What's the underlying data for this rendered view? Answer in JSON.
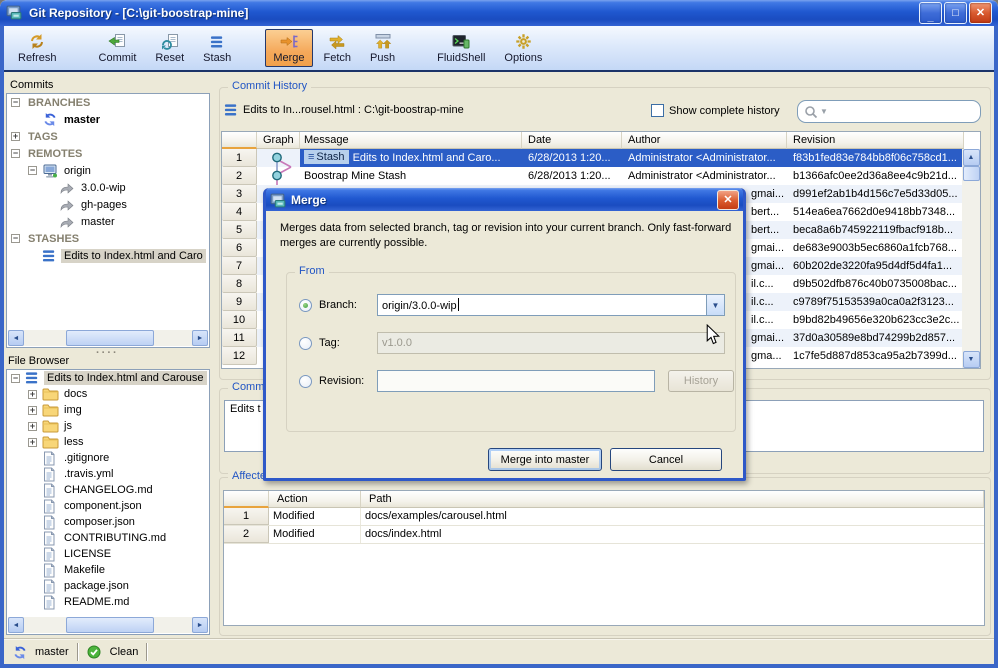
{
  "window": {
    "title": "Git Repository - [C:\\git-boostrap-mine]"
  },
  "toolbar": {
    "items": [
      {
        "id": "refresh",
        "label": "Refresh",
        "icon": "refresh",
        "active": false,
        "gap_before": false
      },
      {
        "id": "commit",
        "label": "Commit",
        "icon": "commit",
        "active": false,
        "gap_before": true
      },
      {
        "id": "reset",
        "label": "Reset",
        "icon": "reset",
        "active": false,
        "gap_before": false
      },
      {
        "id": "stash",
        "label": "Stash",
        "icon": "stash",
        "active": false,
        "gap_before": false
      },
      {
        "id": "merge",
        "label": "Merge",
        "icon": "merge",
        "active": true,
        "gap_before": true
      },
      {
        "id": "fetch",
        "label": "Fetch",
        "icon": "fetch",
        "active": false,
        "gap_before": false
      },
      {
        "id": "push",
        "label": "Push",
        "icon": "push",
        "active": false,
        "gap_before": false
      },
      {
        "id": "fluidshell",
        "label": "FluidShell",
        "icon": "fluidshell",
        "active": false,
        "gap_before": true
      },
      {
        "id": "options",
        "label": "Options",
        "icon": "options",
        "active": false,
        "gap_before": false
      }
    ]
  },
  "commits_panel": {
    "title": "Commits",
    "tree": [
      {
        "depth": 0,
        "expander": "minus",
        "icon": null,
        "label": "BRANCHES",
        "section": true
      },
      {
        "depth": 1,
        "expander": null,
        "icon": "branch",
        "label": "master",
        "bold": true
      },
      {
        "depth": 0,
        "expander": "plus",
        "icon": null,
        "label": "TAGS",
        "section": true
      },
      {
        "depth": 0,
        "expander": "minus",
        "icon": null,
        "label": "REMOTES",
        "section": true
      },
      {
        "depth": 1,
        "expander": "minus",
        "icon": "computer",
        "label": "origin"
      },
      {
        "depth": 2,
        "expander": null,
        "icon": "remote-branch",
        "label": "3.0.0-wip"
      },
      {
        "depth": 2,
        "expander": null,
        "icon": "remote-branch",
        "label": "gh-pages"
      },
      {
        "depth": 2,
        "expander": null,
        "icon": "remote-branch",
        "label": "master"
      },
      {
        "depth": 0,
        "expander": "minus",
        "icon": null,
        "label": "STASHES",
        "section": true
      },
      {
        "depth": 1,
        "expander": null,
        "icon": "stash",
        "label": "Edits to Index.html and Caro",
        "selected": true
      }
    ]
  },
  "file_browser": {
    "title": "File Browser",
    "tree": [
      {
        "depth": 0,
        "expander": "minus",
        "icon": "stash",
        "label": "Edits to Index.html and Carouse",
        "selected": true
      },
      {
        "depth": 1,
        "expander": "plus",
        "icon": "folder",
        "label": "docs"
      },
      {
        "depth": 1,
        "expander": "plus",
        "icon": "folder",
        "label": "img"
      },
      {
        "depth": 1,
        "expander": "plus",
        "icon": "folder",
        "label": "js"
      },
      {
        "depth": 1,
        "expander": "plus",
        "icon": "folder",
        "label": "less"
      },
      {
        "depth": 1,
        "expander": null,
        "icon": "file",
        "label": ".gitignore"
      },
      {
        "depth": 1,
        "expander": null,
        "icon": "file",
        "label": ".travis.yml"
      },
      {
        "depth": 1,
        "expander": null,
        "icon": "file",
        "label": "CHANGELOG.md"
      },
      {
        "depth": 1,
        "expander": null,
        "icon": "file",
        "label": "component.json"
      },
      {
        "depth": 1,
        "expander": null,
        "icon": "file",
        "label": "composer.json"
      },
      {
        "depth": 1,
        "expander": null,
        "icon": "file",
        "label": "CONTRIBUTING.md"
      },
      {
        "depth": 1,
        "expander": null,
        "icon": "file",
        "label": "LICENSE"
      },
      {
        "depth": 1,
        "expander": null,
        "icon": "file",
        "label": "Makefile"
      },
      {
        "depth": 1,
        "expander": null,
        "icon": "file",
        "label": "package.json"
      },
      {
        "depth": 1,
        "expander": null,
        "icon": "file",
        "label": "README.md"
      }
    ]
  },
  "history": {
    "legend": "Commit History",
    "context": "Edits to In...rousel.html : C:\\git-boostrap-mine",
    "show_complete_label": "Show complete history",
    "search_placeholder": "",
    "columns": [
      "",
      "Graph",
      "Message",
      "Date",
      "Author",
      "Revision"
    ],
    "rows": [
      {
        "n": 1,
        "graph": "first",
        "badge": "Stash",
        "message": "Edits to Index.html and Caro...",
        "date": "6/28/2013 1:20...",
        "author": "Administrator <Administrator...",
        "revision": "f83b1fed83e784bb8f06c758cd1...",
        "selected": true
      },
      {
        "n": 2,
        "graph": "second",
        "badge": null,
        "message": "Boostrap Mine Stash",
        "date": "6/28/2013 1:20...",
        "author": "Administrator <Administrator...",
        "revision": "b1366afc0ee2d36a8ee4c9b21d..."
      },
      {
        "n": 3,
        "author_fragment": "gmai...",
        "revision": "d991ef2ab1b4d156c7e5d33d05..."
      },
      {
        "n": 4,
        "author_fragment": "bert...",
        "revision": "514ea6ea7662d0e9418bb7348..."
      },
      {
        "n": 5,
        "author_fragment": "bert...",
        "revision": "beca8a6b745922119fbacf918b..."
      },
      {
        "n": 6,
        "author_fragment": "gmai...",
        "revision": "de683e9003b5ec6860a1fcb768..."
      },
      {
        "n": 7,
        "author_fragment": "gmai...",
        "revision": "60b202de3220fa95d4df5d4fa1..."
      },
      {
        "n": 8,
        "author_fragment": "il.c...",
        "revision": "d9b502dfb876c40b0735008bac..."
      },
      {
        "n": 9,
        "author_fragment": "il.c...",
        "revision": "c9789f75153539a0ca0a2f3123..."
      },
      {
        "n": 10,
        "author_fragment": "il.c...",
        "revision": "b9bd82b49656e320b623cc3e2c..."
      },
      {
        "n": 11,
        "author_fragment": "gmai...",
        "revision": "37d0a30589e8bd74299b2d857..."
      },
      {
        "n": 12,
        "author_fragment": "gma...",
        "revision": "1c7fe5d887d853ca95a2b7399d..."
      }
    ]
  },
  "comment": {
    "legend": "Comment",
    "text": "Edits t"
  },
  "affected": {
    "legend": "Affected Files",
    "columns": [
      "",
      "Action",
      "Path"
    ],
    "rows": [
      {
        "n": 1,
        "action": "Modified",
        "path": "docs/examples/carousel.html"
      },
      {
        "n": 2,
        "action": "Modified",
        "path": "docs/index.html"
      }
    ]
  },
  "dialog": {
    "title": "Merge",
    "description": "Merges data from selected branch, tag or revision into your current branch. Only fast-forward merges are currently possible.",
    "from_legend": "From",
    "branch_label": "Branch:",
    "branch_value": "origin/3.0.0-wip",
    "tag_label": "Tag:",
    "tag_value": "v1.0.0",
    "revision_label": "Revision:",
    "revision_value": "",
    "history_button": "History",
    "merge_button": "Merge into master",
    "cancel_button": "Cancel"
  },
  "statusbar": {
    "branch": "master",
    "state": "Clean"
  },
  "colors": {
    "titlebar_blue": "#2058D0",
    "frame_blue": "#3A66C8",
    "chrome_beige": "#ECE9D8",
    "selection_blue": "#2B5DC6",
    "active_tool_orange": "#F5A95B",
    "stash_badge": "#B7D0EC",
    "header_sort_orange": "#E8A33D",
    "legend_blue": "#2155C4",
    "graph_node_teal": "#92D2DE",
    "graph_line_pink": "#C878B8"
  }
}
